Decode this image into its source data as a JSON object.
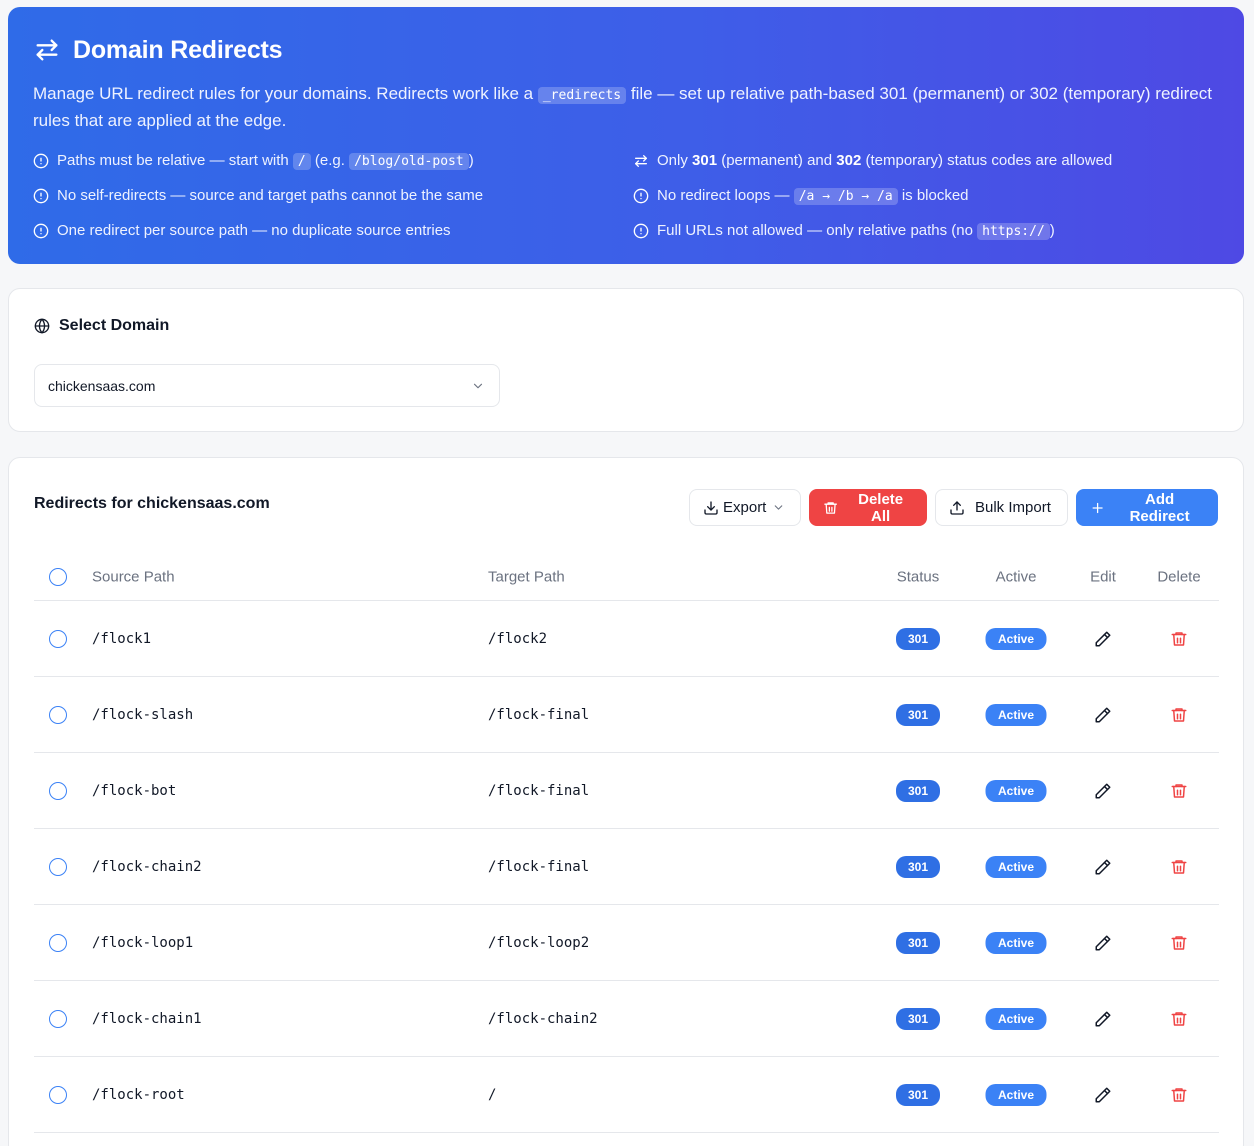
{
  "header": {
    "title": "Domain Redirects",
    "description_pre": "Manage URL redirect rules for your domains. Redirects work like a ",
    "description_code": "_redirects",
    "description_post": " file — set up relative path-based 301 (permanent) or 302 (temporary) redirect rules that are applied at the edge.",
    "rules": {
      "r1_pre": "Paths must be relative — start with ",
      "r1_code1": "/",
      "r1_mid": " (e.g. ",
      "r1_code2": "/blog/old-post",
      "r1_post": ")",
      "r2_pre": "Only ",
      "r2_b1": "301",
      "r2_mid": " (permanent) and ",
      "r2_b2": "302",
      "r2_post": " (temporary) status codes are allowed",
      "r3": "No self-redirects — source and target paths cannot be the same",
      "r4_pre": "No redirect loops — ",
      "r4_code": "/a → /b → /a",
      "r4_post": " is blocked",
      "r5": "One redirect per source path — no duplicate source entries",
      "r6_pre": "Full URLs not allowed — only relative paths (no ",
      "r6_code": "https://",
      "r6_post": ")"
    }
  },
  "domain_select": {
    "label": "Select Domain",
    "value": "chickensaas.com"
  },
  "redirects": {
    "title": "Redirects for chickensaas.com",
    "buttons": {
      "export": "Export",
      "delete_all": "Delete All",
      "bulk_import": "Bulk Import",
      "add": "Add Redirect"
    },
    "columns": {
      "source": "Source Path",
      "target": "Target Path",
      "status": "Status",
      "active": "Active",
      "edit": "Edit",
      "delete": "Delete"
    },
    "rows": [
      {
        "source": "/flock1",
        "target": "/flock2",
        "status": "301",
        "active": "Active"
      },
      {
        "source": "/flock-slash",
        "target": "/flock-final",
        "status": "301",
        "active": "Active"
      },
      {
        "source": "/flock-bot",
        "target": "/flock-final",
        "status": "301",
        "active": "Active"
      },
      {
        "source": "/flock-chain2",
        "target": "/flock-final",
        "status": "301",
        "active": "Active"
      },
      {
        "source": "/flock-loop1",
        "target": "/flock-loop2",
        "status": "301",
        "active": "Active"
      },
      {
        "source": "/flock-chain1",
        "target": "/flock-chain2",
        "status": "301",
        "active": "Active"
      },
      {
        "source": "/flock-root",
        "target": "/",
        "status": "301",
        "active": "Active"
      }
    ]
  },
  "colors": {
    "primary": "#3b82f6",
    "danger": "#ef4444",
    "hero_start": "#2f6be8",
    "hero_end": "#4e49e4"
  }
}
